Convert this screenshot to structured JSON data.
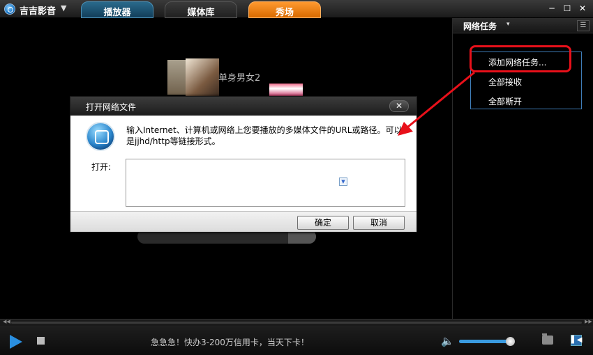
{
  "app": {
    "title": "吉吉影音",
    "menu_icon": "dropdown-triangle"
  },
  "tabs": [
    {
      "label": "播放器"
    },
    {
      "label": "媒体库"
    },
    {
      "label": "秀场"
    }
  ],
  "window_controls": {
    "minimize": "─",
    "maximize": "☐",
    "close": "✕"
  },
  "side_panel": {
    "title": "网络任务",
    "caret": "▾",
    "list_icon": "☰",
    "menu": [
      {
        "label": "添加网络任务..."
      },
      {
        "label": "全部接收"
      },
      {
        "label": "全部断开"
      }
    ]
  },
  "background": {
    "movie_text": "单身男女2"
  },
  "dialog": {
    "title": "打开网络文件",
    "close": "✕",
    "message": "输入Internet、计算机或网络上您要播放的多媒体文件的URL或路径。可以是jjhd/http等链接形式。",
    "open_label": "打开:",
    "input_value": "",
    "ok_label": "确定",
    "cancel_label": "取消"
  },
  "bottom_bar": {
    "ad_text": "急急急！快办3-200万信用卡，当天下卡！",
    "volume_fraction": 0.92
  },
  "colors": {
    "accent_blue": "#2a8fe0",
    "tab_show_orange": "#e87a10",
    "annotation_red": "#e8101a"
  }
}
